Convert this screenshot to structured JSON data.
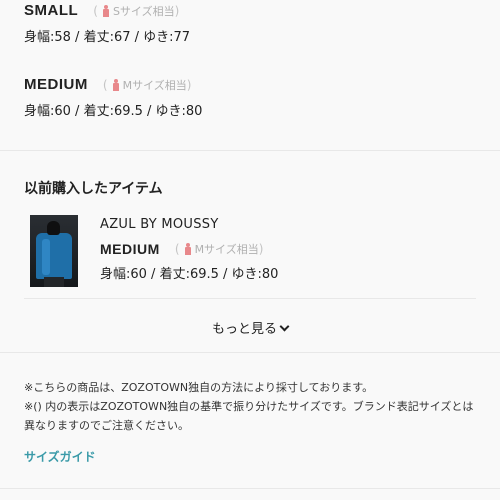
{
  "sizes": [
    {
      "name": "SMALL",
      "hint_open": "(",
      "hint_label": "Sサイズ相当",
      "hint_close": ")",
      "measurements": "身幅:58 / 着丈:67 / ゆき:77"
    },
    {
      "name": "MEDIUM",
      "hint_open": "(",
      "hint_label": "Mサイズ相当",
      "hint_close": ")",
      "measurements": "身幅:60 / 着丈:69.5 / ゆき:80"
    }
  ],
  "previous": {
    "title": "以前購入したアイテム",
    "item": {
      "brand": "AZUL BY MOUSSY",
      "size_name": "MEDIUM",
      "hint_open": "(",
      "hint_label": "Mサイズ相当",
      "hint_close": ")",
      "measurements": "身幅:60 / 着丈:69.5 / ゆき:80"
    },
    "more_label": "もっと見る"
  },
  "notes": [
    "※こちらの商品は、ZOZOTOWN独自の方法により採寸しております。",
    "※() 内の表示はZOZOTOWN独自の基準で振り分けたサイズです。ブランド表記サイズとは異なりますのでご注意ください。"
  ],
  "size_guide_label": "サイズガイド",
  "colors": {
    "accent": "#3a9aa8",
    "person_icon": "#e8888b",
    "hint_text": "#b0b0b0"
  },
  "icons": {
    "size_hint": "person-icon",
    "more": "chevron-down-icon"
  }
}
